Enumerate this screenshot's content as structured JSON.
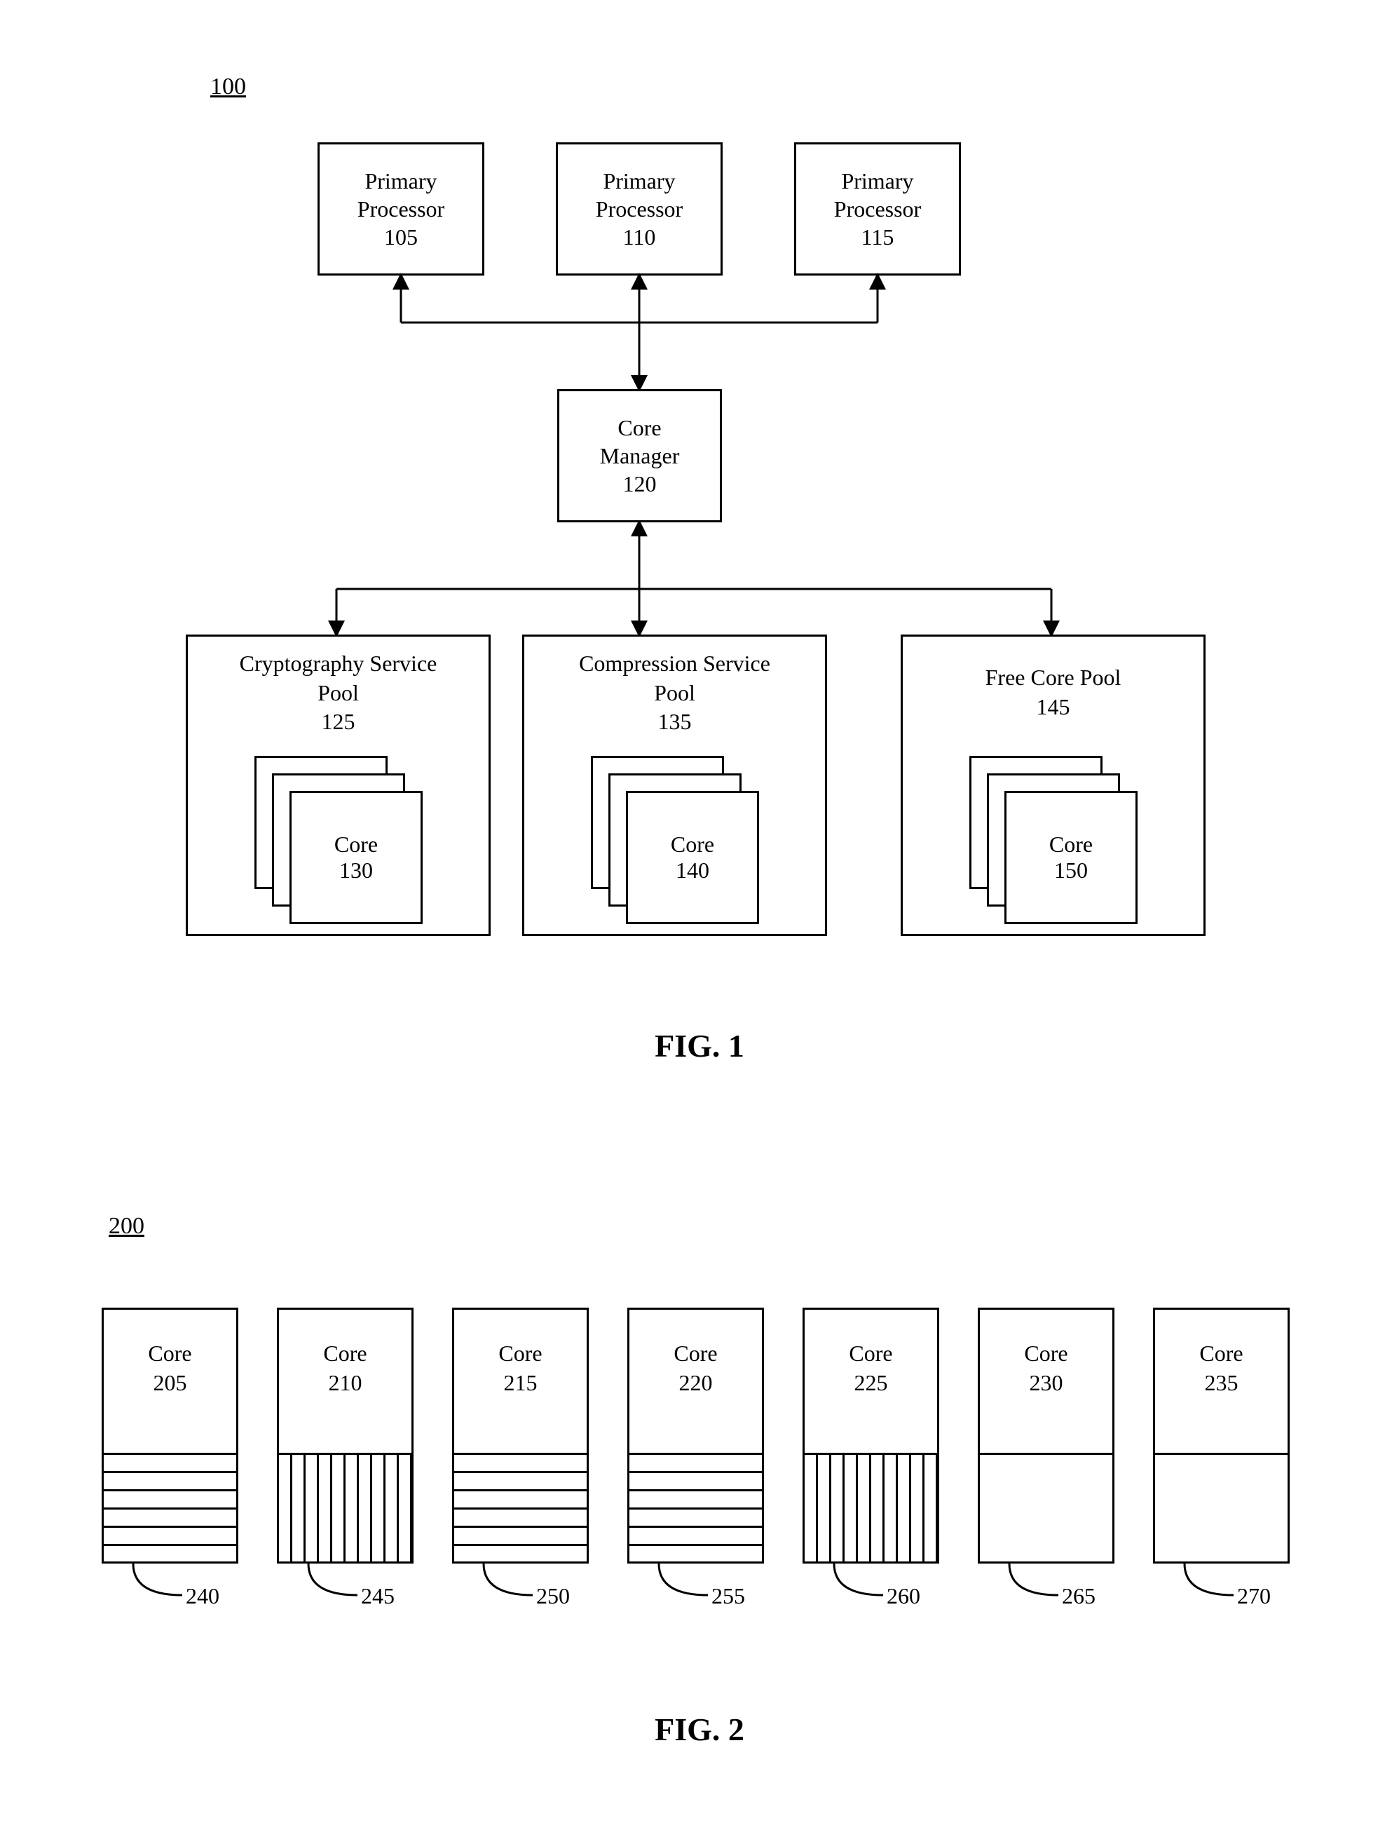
{
  "fig1": {
    "ref": "100",
    "processors": [
      {
        "label": "Primary\nProcessor",
        "num": "105"
      },
      {
        "label": "Primary\nProcessor",
        "num": "110"
      },
      {
        "label": "Primary\nProcessor",
        "num": "115"
      }
    ],
    "manager": {
      "label": "Core\nManager",
      "num": "120"
    },
    "pools": [
      {
        "title": "Cryptography Service\nPool",
        "num": "125",
        "core_label": "Core",
        "core_num": "130"
      },
      {
        "title": "Compression Service\nPool",
        "num": "135",
        "core_label": "Core",
        "core_num": "140"
      },
      {
        "title": "Free Core Pool",
        "num": "145",
        "core_label": "Core",
        "core_num": "150"
      }
    ],
    "caption": "FIG. 1"
  },
  "fig2": {
    "ref": "200",
    "cores": [
      {
        "label": "Core",
        "num": "205",
        "callout": "240",
        "fill": "horiz",
        "h": 155
      },
      {
        "label": "Core",
        "num": "210",
        "callout": "245",
        "fill": "vert",
        "h": 155
      },
      {
        "label": "Core",
        "num": "215",
        "callout": "250",
        "fill": "horiz",
        "h": 155
      },
      {
        "label": "Core",
        "num": "220",
        "callout": "255",
        "fill": "horiz",
        "h": 155
      },
      {
        "label": "Core",
        "num": "225",
        "callout": "260",
        "fill": "vert",
        "h": 155
      },
      {
        "label": "Core",
        "num": "230",
        "callout": "265",
        "fill": "blank",
        "h": 155
      },
      {
        "label": "Core",
        "num": "235",
        "callout": "270",
        "fill": "blank",
        "h": 155
      }
    ],
    "caption": "FIG. 2"
  }
}
